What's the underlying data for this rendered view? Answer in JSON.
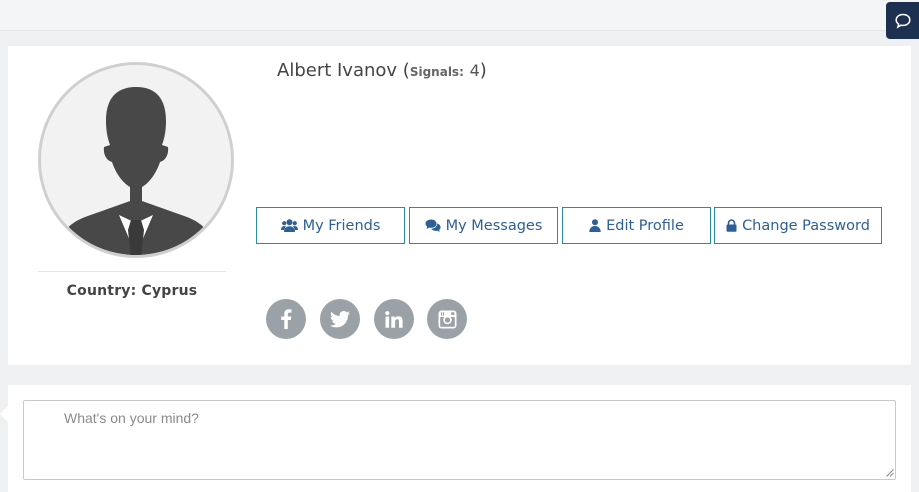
{
  "header": {
    "chat_icon": "speech-bubble-icon"
  },
  "profile": {
    "name": "Albert Ivanov",
    "signals_label": "Signals:",
    "signals_count": "4",
    "country_line": "Country: Cyprus",
    "avatar_icon": "default-user-silhouette"
  },
  "actions": [
    {
      "label": "My Friends",
      "icon": "users-icon"
    },
    {
      "label": "My Messages",
      "icon": "comments-icon"
    },
    {
      "label": "Edit Profile",
      "icon": "user-icon"
    },
    {
      "label": "Change Password",
      "icon": "lock-icon"
    }
  ],
  "social": [
    "facebook-icon",
    "twitter-icon",
    "linkedin-icon",
    "instagram-icon"
  ],
  "post": {
    "placeholder": "What's on your mind?"
  },
  "colors": {
    "accent_border": "#2a8aa0",
    "button_text": "#2e5f96",
    "social_bg": "#9aa1a7",
    "chat_bg": "#1e3050"
  }
}
